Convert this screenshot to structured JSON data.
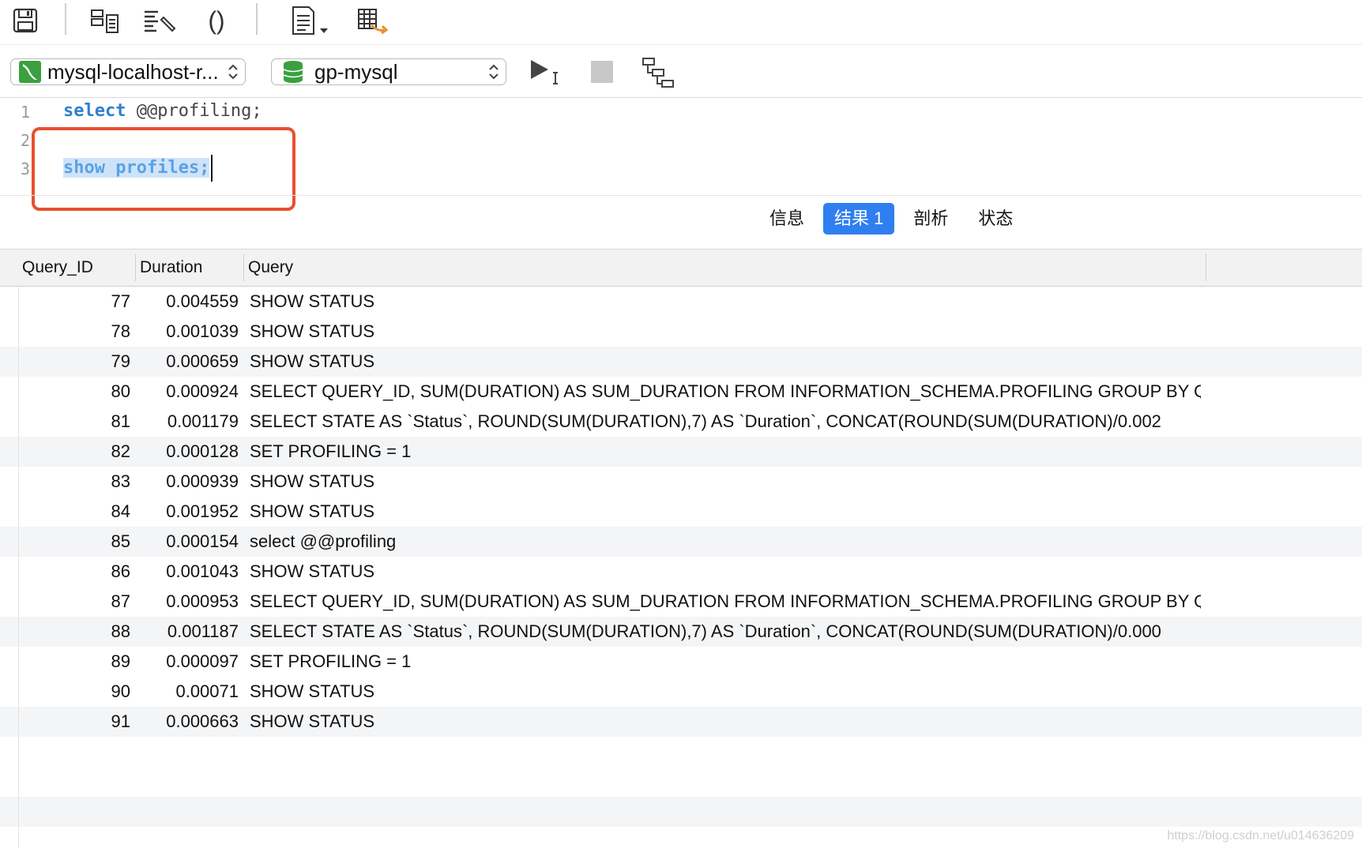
{
  "toolbar": {
    "icons": [
      "save-icon",
      "new-query-icon",
      "beautify-icon",
      "parentheses-icon",
      "code-snippet-icon",
      "export-table-icon"
    ],
    "parentheses_label": "()"
  },
  "connection": {
    "label": "mysql-localhost-r..."
  },
  "database": {
    "label": "gp-mysql"
  },
  "editor": {
    "lines": [
      {
        "num": "1",
        "kw": "select",
        "rest": " @@profiling;"
      },
      {
        "num": "2"
      },
      {
        "num": "3",
        "selected": "show profiles;"
      }
    ]
  },
  "tabs": [
    {
      "label": "信息",
      "active": false
    },
    {
      "label": "结果 1",
      "active": true
    },
    {
      "label": "剖析",
      "active": false
    },
    {
      "label": "状态",
      "active": false
    }
  ],
  "grid": {
    "columns": [
      "Query_ID",
      "Duration",
      "Query"
    ],
    "rows": [
      [
        "77",
        "0.004559",
        "SHOW STATUS"
      ],
      [
        "78",
        "0.001039",
        "SHOW STATUS"
      ],
      [
        "79",
        "0.000659",
        "SHOW STATUS"
      ],
      [
        "80",
        "0.000924",
        "SELECT QUERY_ID, SUM(DURATION) AS SUM_DURATION FROM INFORMATION_SCHEMA.PROFILING GROUP BY QU"
      ],
      [
        "81",
        "0.001179",
        "SELECT STATE AS `Status`, ROUND(SUM(DURATION),7) AS `Duration`, CONCAT(ROUND(SUM(DURATION)/0.002"
      ],
      [
        "82",
        "0.000128",
        "SET PROFILING = 1"
      ],
      [
        "83",
        "0.000939",
        "SHOW STATUS"
      ],
      [
        "84",
        "0.001952",
        "SHOW STATUS"
      ],
      [
        "85",
        "0.000154",
        "select @@profiling"
      ],
      [
        "86",
        "0.001043",
        "SHOW STATUS"
      ],
      [
        "87",
        "0.000953",
        "SELECT QUERY_ID, SUM(DURATION) AS SUM_DURATION FROM INFORMATION_SCHEMA.PROFILING GROUP BY QU"
      ],
      [
        "88",
        "0.001187",
        "SELECT STATE AS `Status`, ROUND(SUM(DURATION),7) AS `Duration`, CONCAT(ROUND(SUM(DURATION)/0.000"
      ],
      [
        "89",
        "0.000097",
        "SET PROFILING = 1"
      ],
      [
        "90",
        "0.00071",
        "SHOW STATUS"
      ],
      [
        "91",
        "0.000663",
        "SHOW STATUS"
      ]
    ]
  },
  "watermark": "https://blog.csdn.net/u014636209",
  "colors": {
    "accent": "#2f7ff0",
    "highlight_box": "#e8502f",
    "keyword": "#2f7fd0",
    "db_icon": "#3aa040"
  }
}
